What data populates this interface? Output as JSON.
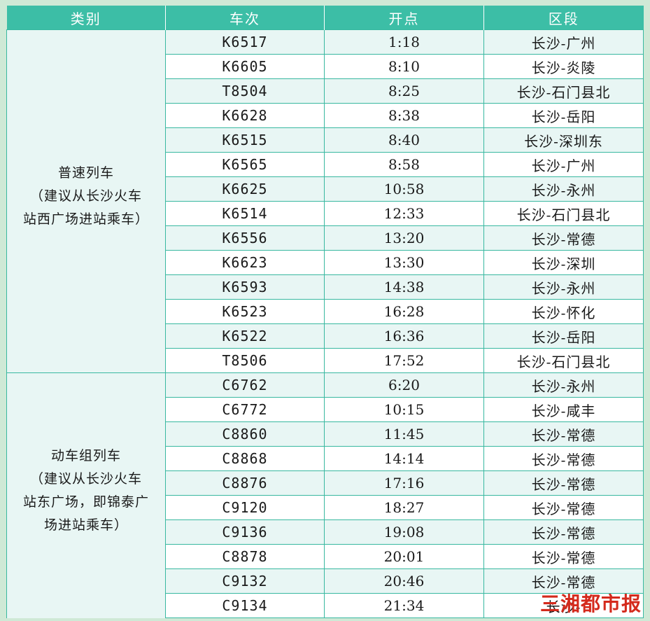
{
  "headers": [
    "类别",
    "车次",
    "开点",
    "区段"
  ],
  "groups": [
    {
      "category_lines": [
        "普速列车",
        "（建议从长沙火车",
        "站西广场进站乘车）"
      ],
      "rows": [
        [
          "K6517",
          "1:18",
          "长沙-广州"
        ],
        [
          "K6605",
          "8:10",
          "长沙-炎陵"
        ],
        [
          "T8504",
          "8:25",
          "长沙-石门县北"
        ],
        [
          "K6628",
          "8:38",
          "长沙-岳阳"
        ],
        [
          "K6515",
          "8:40",
          "长沙-深圳东"
        ],
        [
          "K6565",
          "8:58",
          "长沙-广州"
        ],
        [
          "K6625",
          "10:58",
          "长沙-永州"
        ],
        [
          "K6514",
          "12:33",
          "长沙-石门县北"
        ],
        [
          "K6556",
          "13:20",
          "长沙-常德"
        ],
        [
          "K6623",
          "13:30",
          "长沙-深圳"
        ],
        [
          "K6593",
          "14:38",
          "长沙-永州"
        ],
        [
          "K6523",
          "16:28",
          "长沙-怀化"
        ],
        [
          "K6522",
          "16:36",
          "长沙-岳阳"
        ],
        [
          "T8506",
          "17:52",
          "长沙-石门县北"
        ]
      ]
    },
    {
      "category_lines": [
        "动车组列车",
        "（建议从长沙火车",
        "站东广场，即锦泰广",
        "场进站乘车）"
      ],
      "rows": [
        [
          "C6762",
          "6:20",
          "长沙-永州"
        ],
        [
          "C6772",
          "10:15",
          "长沙-咸丰"
        ],
        [
          "C8860",
          "11:45",
          "长沙-常德"
        ],
        [
          "C8868",
          "14:14",
          "长沙-常德"
        ],
        [
          "C8876",
          "17:16",
          "长沙-常德"
        ],
        [
          "C9120",
          "18:27",
          "长沙-常德"
        ],
        [
          "C9136",
          "19:08",
          "长沙-常德"
        ],
        [
          "C8878",
          "20:01",
          "长沙-常德"
        ],
        [
          "C9132",
          "20:46",
          "长沙-常德"
        ],
        [
          "C9134",
          "21:34",
          "长沙-"
        ]
      ]
    }
  ],
  "watermark": "三湘都市报"
}
